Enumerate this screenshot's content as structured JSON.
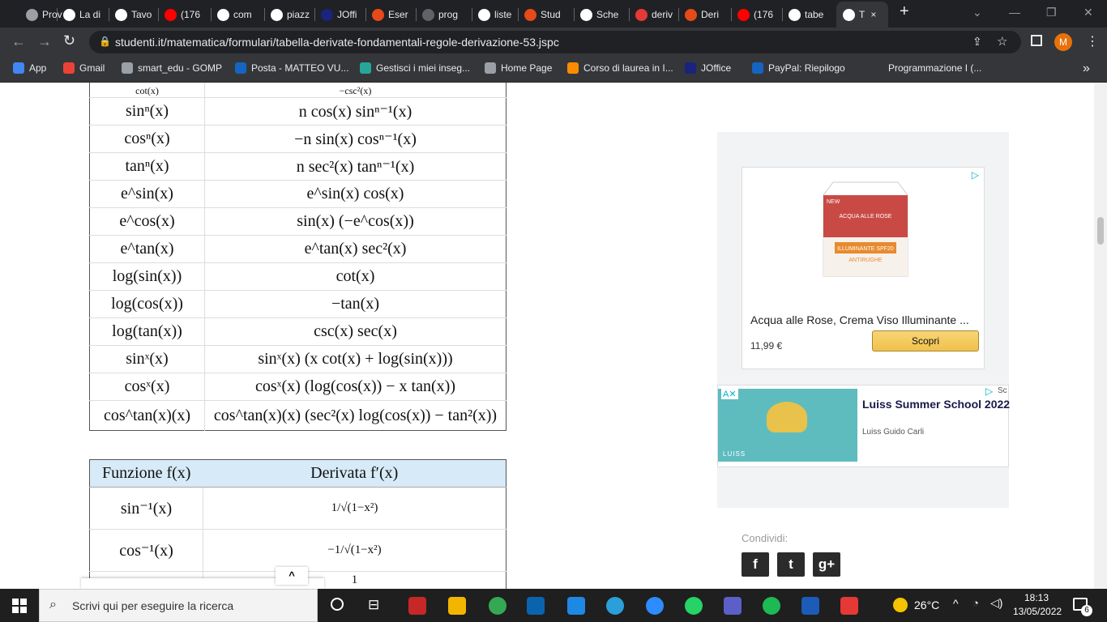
{
  "tabs": [
    "Prov",
    "La di",
    "Tavo",
    "(176",
    "com",
    "piazz",
    "JOffi",
    "Eser",
    "prog",
    "liste",
    "Stud",
    "Sche",
    "deriv",
    "Deri",
    "(176",
    "tabe",
    "T"
  ],
  "tab_active_close": "×",
  "new_tab": "+",
  "window": {
    "minimize": "—",
    "restore": "❐",
    "close": "✕"
  },
  "url": "studenti.it/matematica/formulari/tabella-derivate-fondamentali-regole-derivazione-53.jspc",
  "profile_initial": "M",
  "bookmarks": [
    "App",
    "Gmail",
    "smart_edu - GOMP",
    "Posta - MATTEO VU...",
    "Gestisci i miei inseg...",
    "Home Page",
    "Corso di laurea in I...",
    "JOffice",
    "PayPal: Riepilogo",
    "Programmazione I (..."
  ],
  "bookmarks_more": "»",
  "table1": [
    {
      "f": "cot(x)",
      "d": "−csc²(x)"
    },
    {
      "f": "sinⁿ(x)",
      "d": "n cos(x) sinⁿ⁻¹(x)"
    },
    {
      "f": "cosⁿ(x)",
      "d": "−n sin(x) cosⁿ⁻¹(x)"
    },
    {
      "f": "tanⁿ(x)",
      "d": "n sec²(x) tanⁿ⁻¹(x)"
    },
    {
      "f": "e^sin(x)",
      "d": "e^sin(x) cos(x)"
    },
    {
      "f": "e^cos(x)",
      "d": "sin(x) (−e^cos(x))"
    },
    {
      "f": "e^tan(x)",
      "d": "e^tan(x) sec²(x)"
    },
    {
      "f": "log(sin(x))",
      "d": "cot(x)"
    },
    {
      "f": "log(cos(x))",
      "d": "−tan(x)"
    },
    {
      "f": "log(tan(x))",
      "d": "csc(x) sec(x)"
    },
    {
      "f": "sinˣ(x)",
      "d": "sinˣ(x) (x cot(x) + log(sin(x)))"
    },
    {
      "f": "cosˣ(x)",
      "d": "cosˣ(x) (log(cos(x)) − x tan(x))"
    },
    {
      "f": "cos^tan(x)(x)",
      "d": "cos^tan(x)(x) (sec²(x) log(cos(x)) − tan²(x))"
    }
  ],
  "table2": {
    "header_f": "Funzione f(x)",
    "header_d": "Derivata f′(x)",
    "rows": [
      {
        "f": "sin⁻¹(x)",
        "d": "1/√(1−x²)"
      },
      {
        "f": "cos⁻¹(x)",
        "d": "−1/√(1−x²)"
      },
      {
        "f": "",
        "d": "1"
      }
    ]
  },
  "scroll_up": "^",
  "ad1": {
    "title": "Acqua alle Rose, Crema Viso Illuminante ...",
    "price": "11,99 €",
    "button": "Scopri",
    "pack_new": "NEW",
    "pack_brand": "ACQUA ALLE ROSE",
    "pack_line": "ILLUMINANTE SPF20",
    "pack_sub": "ANTIRUGHE"
  },
  "ad2": {
    "title": "Luiss Summer School 2022",
    "subtitle": "Luiss Guido Carli",
    "corner": "Sc",
    "brand": "LUISS"
  },
  "share": {
    "label": "Condividi:",
    "buttons": [
      "f",
      "t",
      "g+"
    ]
  },
  "taskbar": {
    "search_placeholder": "Scrivi qui per eseguire la ricerca",
    "temperature": "26°C",
    "time": "18:13",
    "date": "13/05/2022",
    "notifications": "6"
  }
}
